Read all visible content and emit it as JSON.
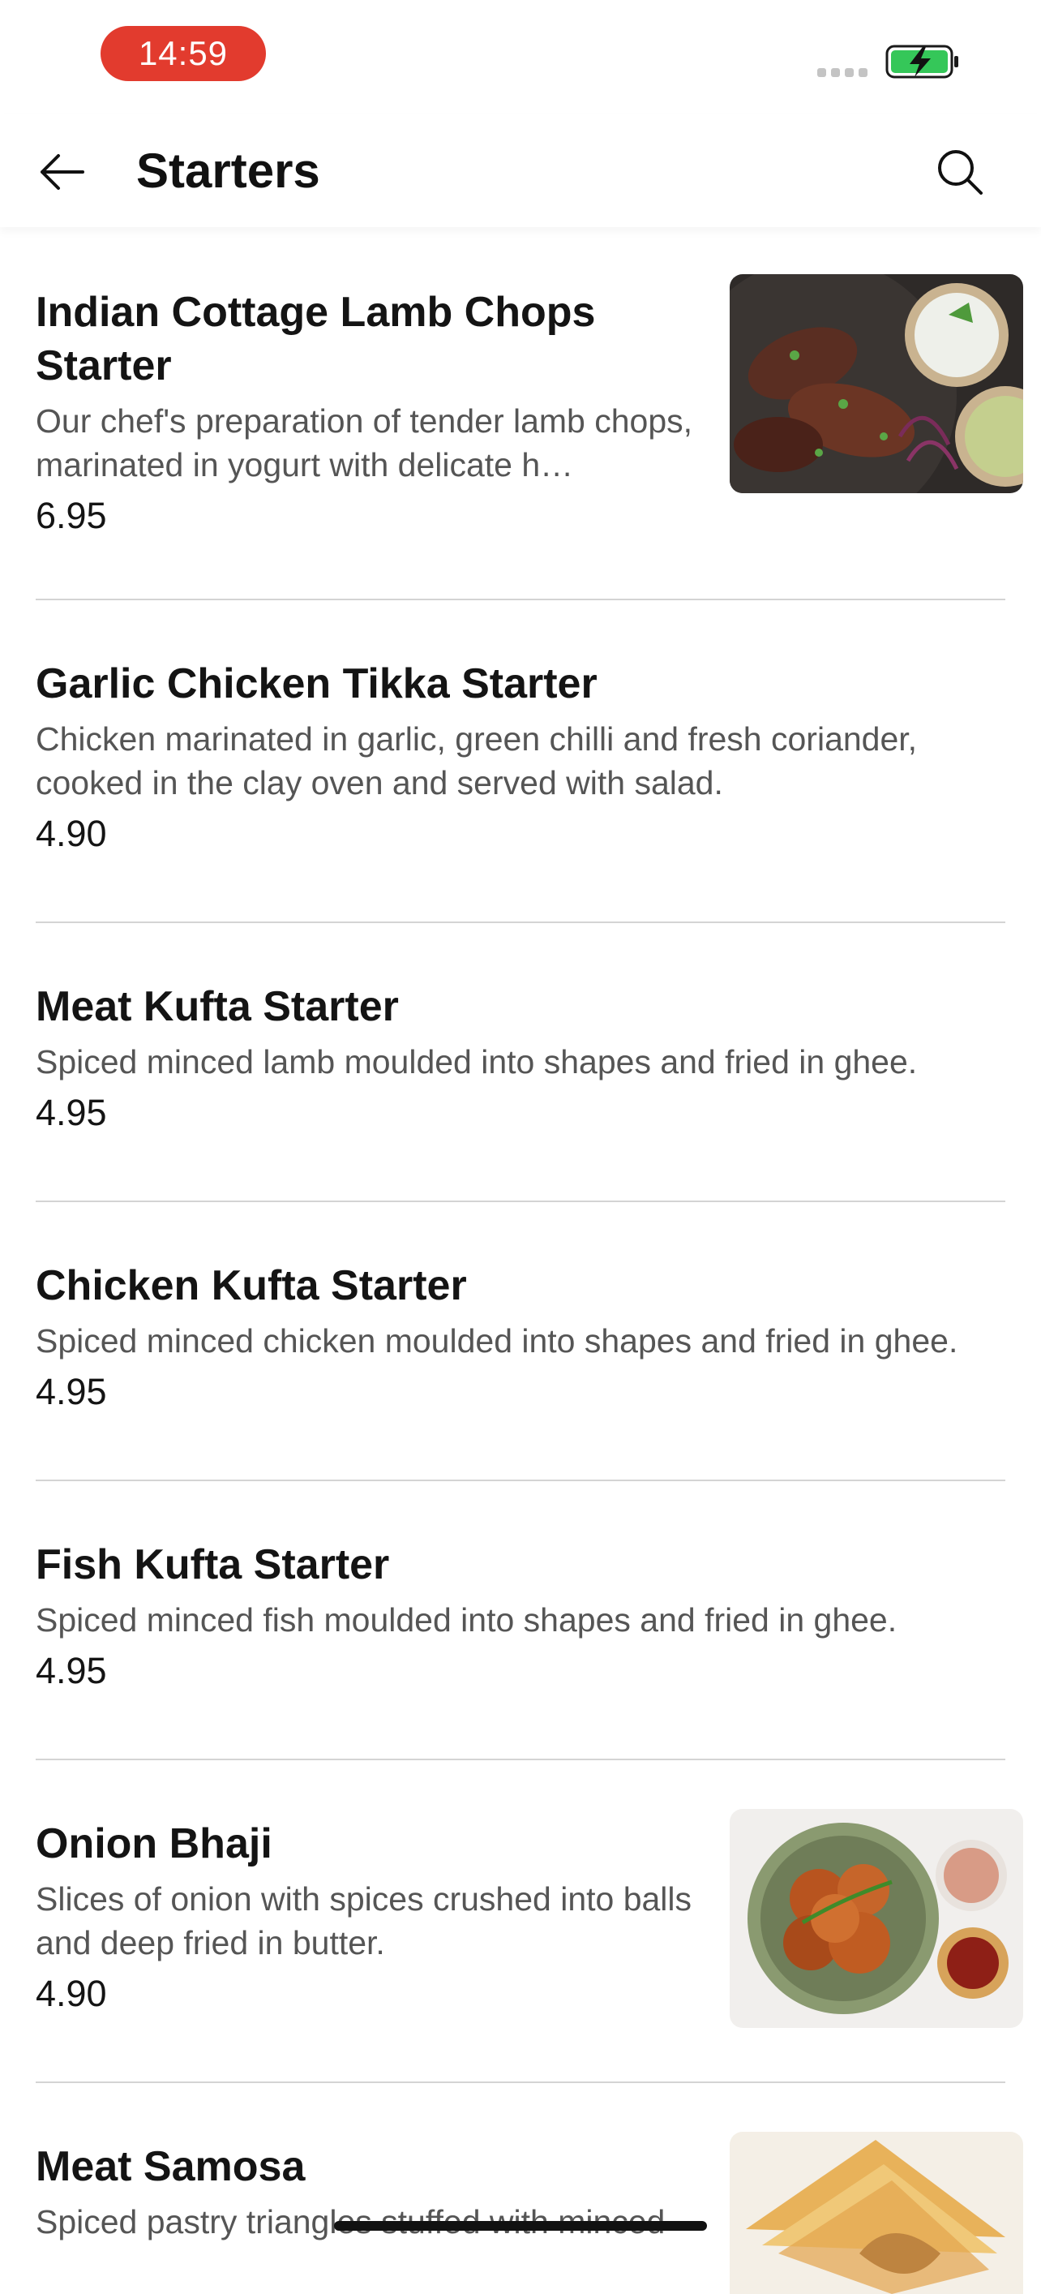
{
  "status": {
    "time": "14:59"
  },
  "header": {
    "title": "Starters"
  },
  "items": [
    {
      "name": "Indian Cottage Lamb Chops Starter",
      "description": "Our chef's preparation of tender lamb chops, marinated in yogurt with delicate h…",
      "price": "6.95"
    },
    {
      "name": "Garlic Chicken Tikka Starter",
      "description": "Chicken marinated in garlic, green chilli and fresh coriander, cooked in the clay oven and served with salad.",
      "price": "4.90"
    },
    {
      "name": "Meat Kufta Starter",
      "description": "Spiced minced lamb moulded into shapes and fried in ghee.",
      "price": "4.95"
    },
    {
      "name": "Chicken Kufta Starter",
      "description": "Spiced minced chicken moulded into shapes and fried in ghee.",
      "price": "4.95"
    },
    {
      "name": "Fish Kufta Starter",
      "description": "Spiced minced fish moulded into shapes and fried in ghee.",
      "price": "4.95"
    },
    {
      "name": "Onion Bhaji",
      "description": "Slices of onion with spices crushed into balls and deep fried in butter.",
      "price": "4.90"
    },
    {
      "name": "Meat Samosa",
      "description": "Spiced pastry triangles stuffed with minced"
    }
  ],
  "colors": {
    "time_pill": "#e23b2e",
    "battery": "#35c759",
    "divider": "#d4d4d4"
  },
  "icons": {
    "back": "arrow-left-icon",
    "search": "search-icon",
    "battery": "battery-charging-icon"
  }
}
